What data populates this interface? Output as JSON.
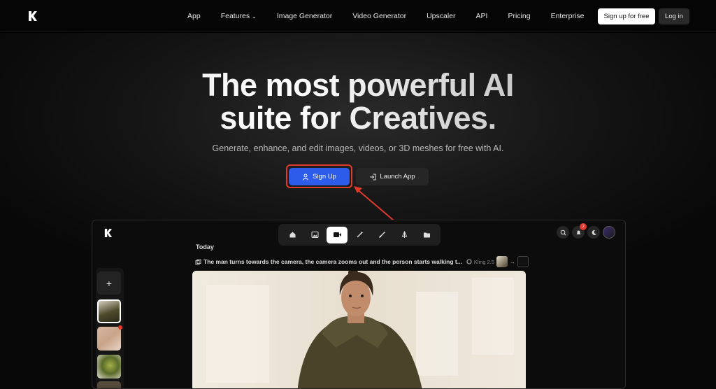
{
  "nav": {
    "links": [
      "App",
      "Features",
      "Image Generator",
      "Video Generator",
      "Upscaler",
      "API",
      "Pricing",
      "Enterprise"
    ],
    "signup_free": "Sign up for free",
    "login": "Log in"
  },
  "hero": {
    "headline_line1": "The most powerful AI",
    "headline_line2": "suite for Creatives.",
    "subtitle": "Generate, enhance, and edit images, videos, or 3D meshes for free with AI.",
    "signup_label": "Sign Up",
    "launch_label": "Launch App"
  },
  "app_preview": {
    "section_label": "Today",
    "prompt": "The man turns towards the camera, the camera zooms out and the person starts walking t...",
    "model": "Kling 2.5",
    "notification_count": "7",
    "toolbar_icons": [
      "home-icon",
      "image-icon",
      "video-icon",
      "magic-wand-icon",
      "brush-icon",
      "pen-icon",
      "folder-icon"
    ],
    "active_tool": "video-icon"
  },
  "colors": {
    "accent_blue": "#2d5bea",
    "highlight_red": "#e03a2a",
    "background": "#000000"
  }
}
